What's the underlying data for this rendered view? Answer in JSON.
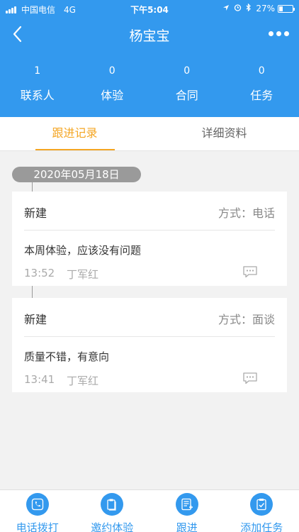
{
  "status_bar": {
    "carrier": "中国电信",
    "network": "4G",
    "time": "下午5:04",
    "battery_percent": "27%",
    "battery_level": 0.27
  },
  "nav": {
    "title": "杨宝宝",
    "back_icon": "chevron-left-icon",
    "more_icon": "more-dots-icon"
  },
  "stats": [
    {
      "value": "1",
      "label": "联系人"
    },
    {
      "value": "0",
      "label": "体验"
    },
    {
      "value": "0",
      "label": "合同"
    },
    {
      "value": "0",
      "label": "任务"
    }
  ],
  "tabs": [
    {
      "label": "跟进记录",
      "active": true
    },
    {
      "label": "详细资料",
      "active": false
    }
  ],
  "timeline": {
    "date": "2020年05月18日",
    "records": [
      {
        "type": "新建",
        "method": "方式：电话",
        "content": "本周体验，应该没有问题",
        "time": "13:52",
        "user": "丁军红"
      },
      {
        "type": "新建",
        "method": "方式：面谈",
        "content": "质量不错，有意向",
        "time": "13:41",
        "user": "丁军红"
      }
    ]
  },
  "bottom_bar": [
    {
      "label": "电话拨打",
      "icon": "phone-icon"
    },
    {
      "label": "邀约体验",
      "icon": "clipboard-icon"
    },
    {
      "label": "跟进",
      "icon": "follow-list-icon"
    },
    {
      "label": "添加任务",
      "icon": "task-add-icon"
    }
  ],
  "colors": {
    "primary": "#3399ee",
    "accent": "#f4a623"
  }
}
